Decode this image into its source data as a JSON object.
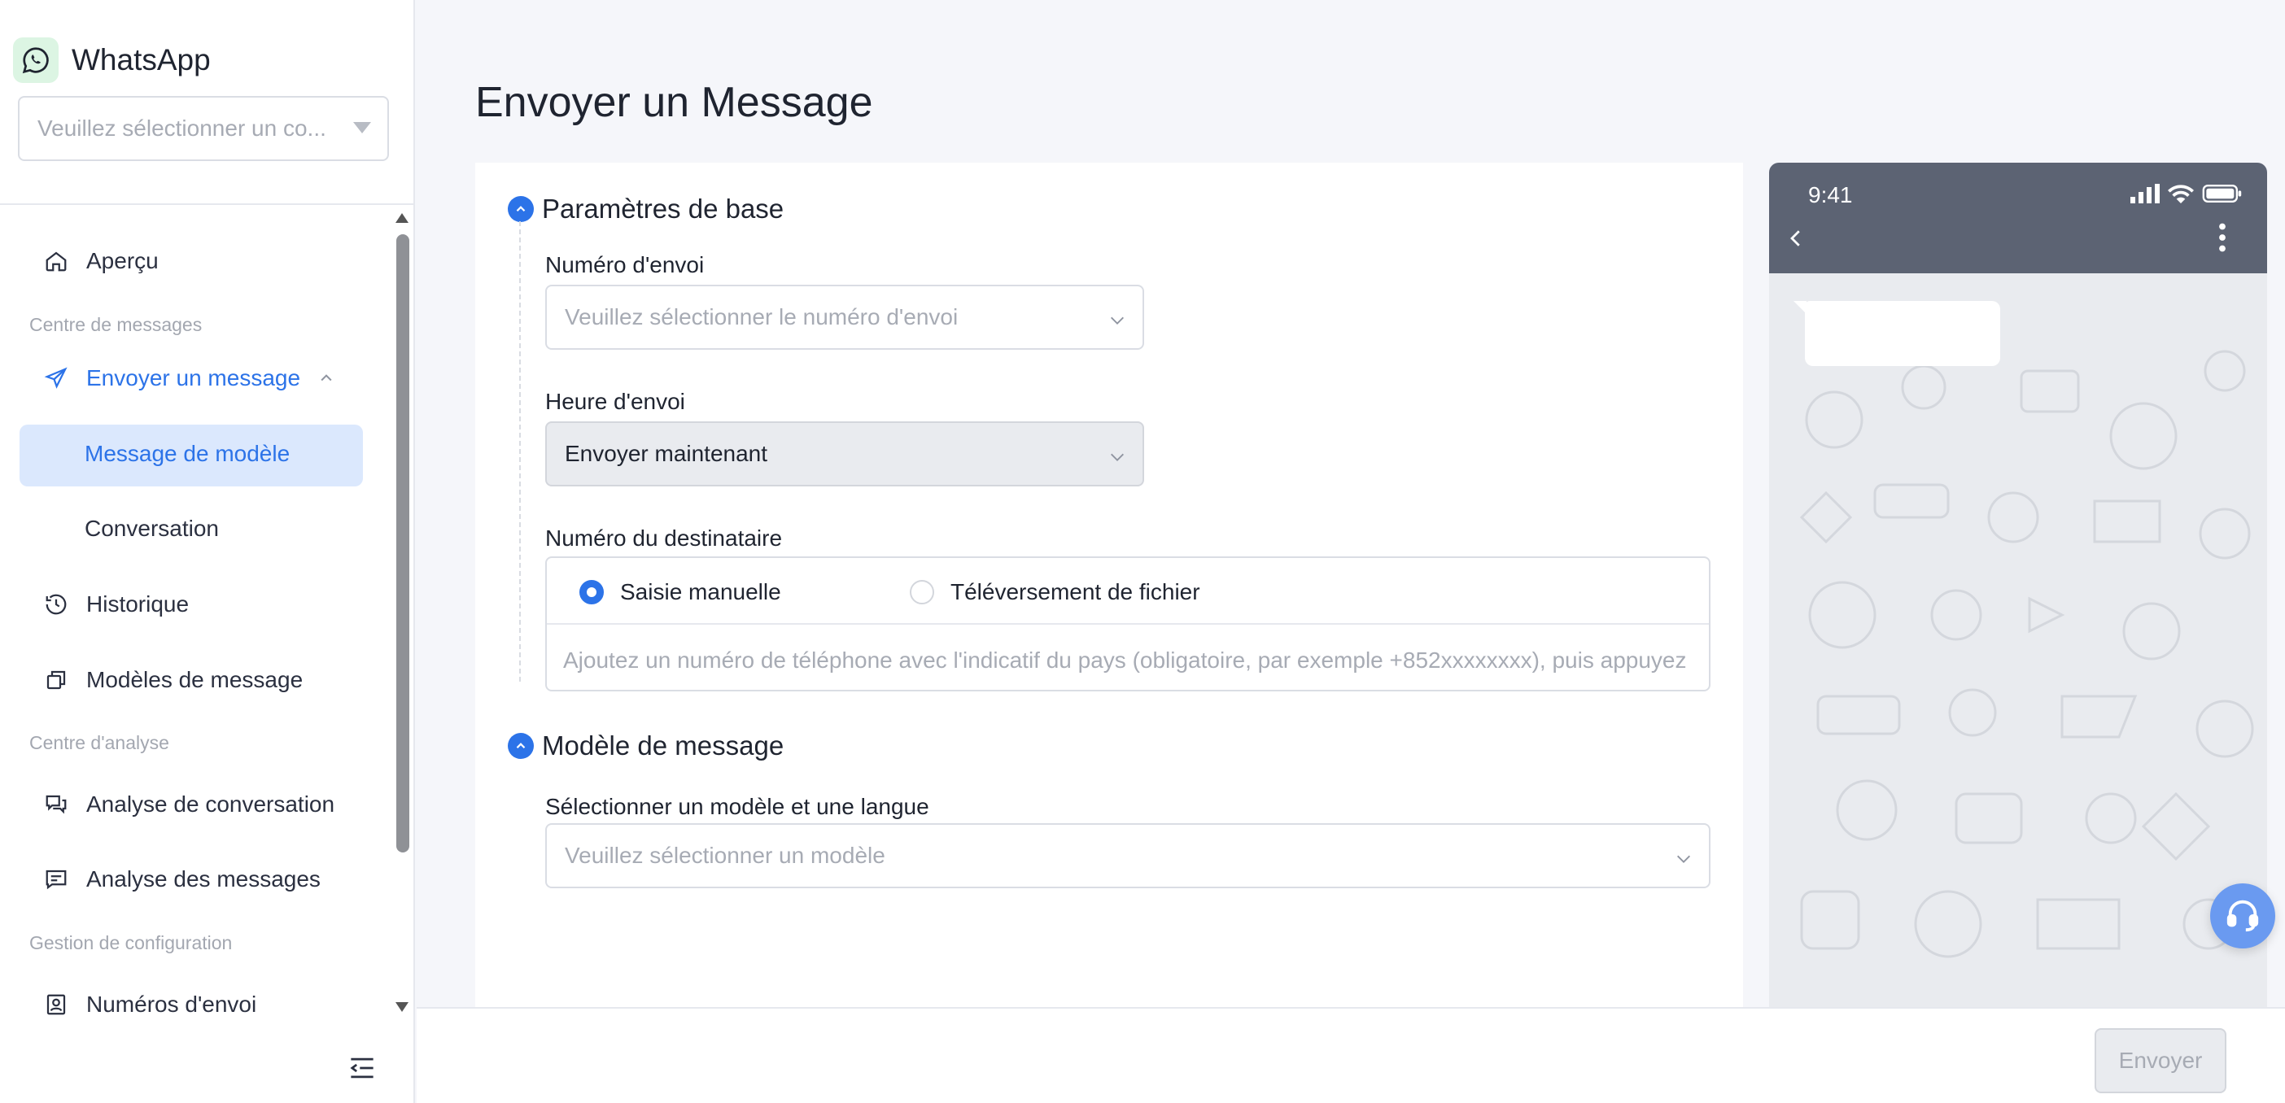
{
  "app": {
    "name": "WhatsApp",
    "accent": "#2c73e8"
  },
  "sidebar": {
    "account_placeholder": "Veuillez sélectionner un co...",
    "items": {
      "overview": "Aperçu",
      "group_messages": "Centre de messages",
      "send_message": "Envoyer un message",
      "template_message": "Message de modèle",
      "conversation": "Conversation",
      "history": "Historique",
      "message_templates": "Modèles de message",
      "group_analysis": "Centre d'analyse",
      "conversation_analysis": "Analyse de conversation",
      "message_analysis": "Analyse des messages",
      "group_config": "Gestion de configuration",
      "sender_numbers": "Numéros d'envoi"
    }
  },
  "main": {
    "title": "Envoyer un Message",
    "basic": {
      "heading": "Paramètres de base",
      "sender_label": "Numéro d'envoi",
      "sender_placeholder": "Veuillez sélectionner le numéro d'envoi",
      "time_label": "Heure d'envoi",
      "time_value": "Envoyer maintenant",
      "recipient_label": "Numéro du destinataire",
      "radio_manual": "Saisie manuelle",
      "radio_file": "Téléversement de fichier",
      "recipient_placeholder": "Ajoutez un numéro de téléphone avec l'indicatif du pays (obligatoire, par exemple +852xxxxxxxx), puis appuyez"
    },
    "template": {
      "heading": "Modèle de message",
      "select_label": "Sélectionner un modèle et une langue",
      "select_placeholder": "Veuillez sélectionner un modèle"
    }
  },
  "preview": {
    "time": "9:41"
  },
  "footer": {
    "send_label": "Envoyer"
  }
}
